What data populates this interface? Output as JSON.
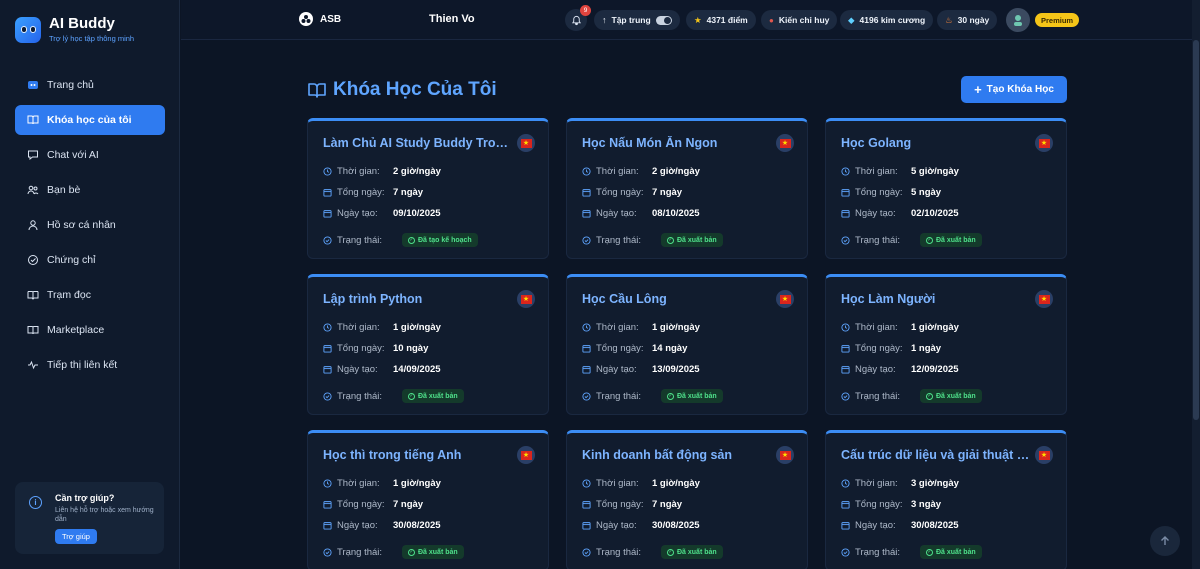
{
  "brand": {
    "title": "AI Buddy",
    "subtitle": "Trợ lý học tập thông minh",
    "logo_icon": "buddy-face-icon",
    "accent": "#2f7bf0"
  },
  "sidebar": {
    "items": [
      {
        "label": "Trang chủ",
        "icon": "home-icon",
        "active": false
      },
      {
        "label": "Khóa học của tôi",
        "icon": "book-icon",
        "active": true
      },
      {
        "label": "Chat với AI",
        "icon": "chat-icon",
        "active": false
      },
      {
        "label": "Bạn bè",
        "icon": "friends-icon",
        "active": false
      },
      {
        "label": "Hồ sơ cá nhân",
        "icon": "user-icon",
        "active": false
      },
      {
        "label": "Chứng chỉ",
        "icon": "certificate-icon",
        "active": false
      },
      {
        "label": "Trạm đọc",
        "icon": "reading-icon",
        "active": false
      },
      {
        "label": "Marketplace",
        "icon": "marketplace-icon",
        "active": false
      },
      {
        "label": "Tiếp thị liên kết",
        "icon": "affiliate-icon",
        "active": false
      }
    ],
    "help": {
      "title": "Cần trợ giúp?",
      "text": "Liên hệ hỗ trợ hoặc xem hướng dẫn",
      "button": "Trợ giúp"
    }
  },
  "topbar": {
    "org": "ASB",
    "user_name": "Thien Vo",
    "notifications": "9",
    "focus_label": "Tập trung",
    "points": "4371 điểm",
    "rank": "Kiến chỉ huy",
    "diamonds": "4196 kim cương",
    "streak": "30 ngày",
    "plan": "Premium"
  },
  "main": {
    "title": "Khóa Học Của Tôi",
    "create_button": "Tạo Khóa Học",
    "labels": {
      "time": "Thời gian:",
      "days": "Tổng ngày:",
      "created": "Ngày tạo:",
      "status": "Trạng thái:"
    },
    "courses": [
      {
        "title": "Làm Chủ AI Study Buddy Trong...",
        "time": "2 giờ/ngày",
        "days": "7 ngày",
        "created": "09/10/2025",
        "status": "Đã tạo kế hoạch"
      },
      {
        "title": "Học Nấu Món Ăn Ngon",
        "time": "2 giờ/ngày",
        "days": "7 ngày",
        "created": "08/10/2025",
        "status": "Đã xuất bản"
      },
      {
        "title": "Học Golang",
        "time": "5 giờ/ngày",
        "days": "5 ngày",
        "created": "02/10/2025",
        "status": "Đã xuất bản"
      },
      {
        "title": "Lập trình Python",
        "time": "1 giờ/ngày",
        "days": "10 ngày",
        "created": "14/09/2025",
        "status": "Đã xuất bản"
      },
      {
        "title": "Học Cầu Lông",
        "time": "1 giờ/ngày",
        "days": "14 ngày",
        "created": "13/09/2025",
        "status": "Đã xuất bản"
      },
      {
        "title": "Học Làm Người",
        "time": "1 giờ/ngày",
        "days": "1 ngày",
        "created": "12/09/2025",
        "status": "Đã xuất bản"
      },
      {
        "title": "Học thì trong tiếng Anh",
        "time": "1 giờ/ngày",
        "days": "7 ngày",
        "created": "30/08/2025",
        "status": "Đã xuất bản"
      },
      {
        "title": "Kinh doanh bất động sản",
        "time": "1 giờ/ngày",
        "days": "7 ngày",
        "created": "30/08/2025",
        "status": "Đã xuất bản"
      },
      {
        "title": "Cấu trúc dữ liệu và giải thuật n...",
        "time": "3 giờ/ngày",
        "days": "3 ngày",
        "created": "30/08/2025",
        "status": "Đã xuất bản"
      }
    ]
  },
  "colors": {
    "background": "#0c1525",
    "card": "#111c2e",
    "title": "#7db4ff",
    "status_green": "#4ee08a",
    "premium": "#f5c518"
  }
}
